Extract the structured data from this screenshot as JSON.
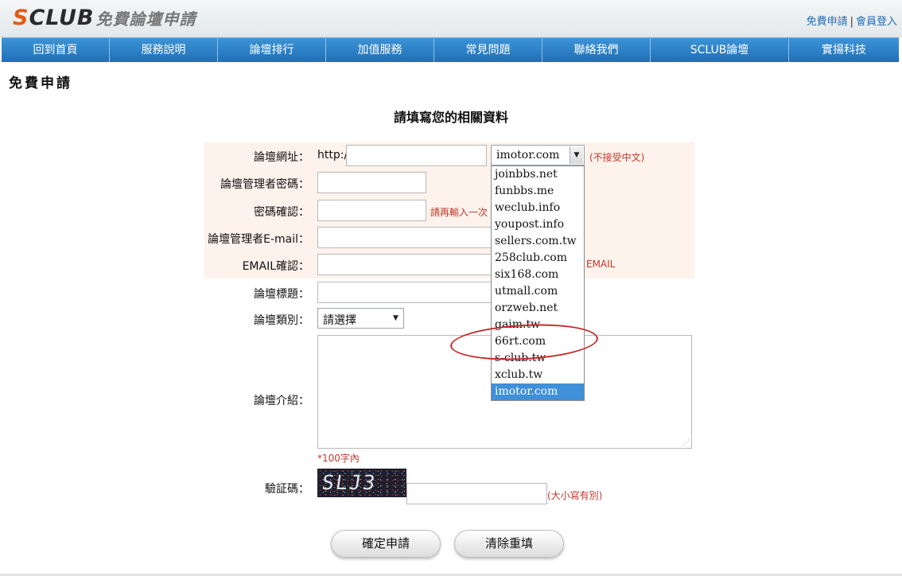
{
  "header": {
    "logo_brand_s": "S",
    "logo_brand_rest": "CLUB",
    "logo_sub": "免費論壇申請",
    "links": [
      "免費申請",
      "會員登入"
    ],
    "separator": "|"
  },
  "nav": {
    "items": [
      "回到首頁",
      "服務說明",
      "論壇排行",
      "加值服務",
      "常見問題",
      "聯絡我們",
      "SCLUB論壇",
      "實揚科技"
    ]
  },
  "page": {
    "section_title": "免費申請",
    "form_title": "請填寫您的相關資料"
  },
  "form": {
    "url_label": "論壇網址：",
    "url_prefix": "http://",
    "url_value": "",
    "domain_selected": "imotor.com",
    "domain_note": "(不接受中文)",
    "domain_options": [
      "joinbbs.net",
      "funbbs.me",
      "weclub.info",
      "youpost.info",
      "sellers.com.tw",
      "258club.com",
      "six168.com",
      "utmall.com",
      "orzweb.net",
      "gaim.tw",
      "66rt.com",
      "s-club.tw",
      "xclub.tw",
      "imotor.com"
    ],
    "password_label": "論壇管理者密碼：",
    "confirm_label": "密碼確認：",
    "confirm_note": "請再輸入一次",
    "email_label": "論壇管理者E-mail：",
    "email_confirm_label": "EMAIL確認：",
    "email_confirm_note": "EMAIL",
    "title_label": "論壇標題：",
    "category_label": "論壇類別：",
    "category_selected": "請選擇",
    "intro_label": "論壇介紹：",
    "intro_note": "*100字內",
    "captcha_label": "驗証碼：",
    "captcha_text": "SLJ3",
    "captcha_note": "(大小寫有別)",
    "submit_label": "確定申請",
    "reset_label": "清除重填"
  },
  "colors": {
    "nav_blue": "#1e6fb7",
    "note_red": "#c0392b",
    "highlight_circle": "#c62828",
    "selected_option": "#3f8fd9"
  }
}
